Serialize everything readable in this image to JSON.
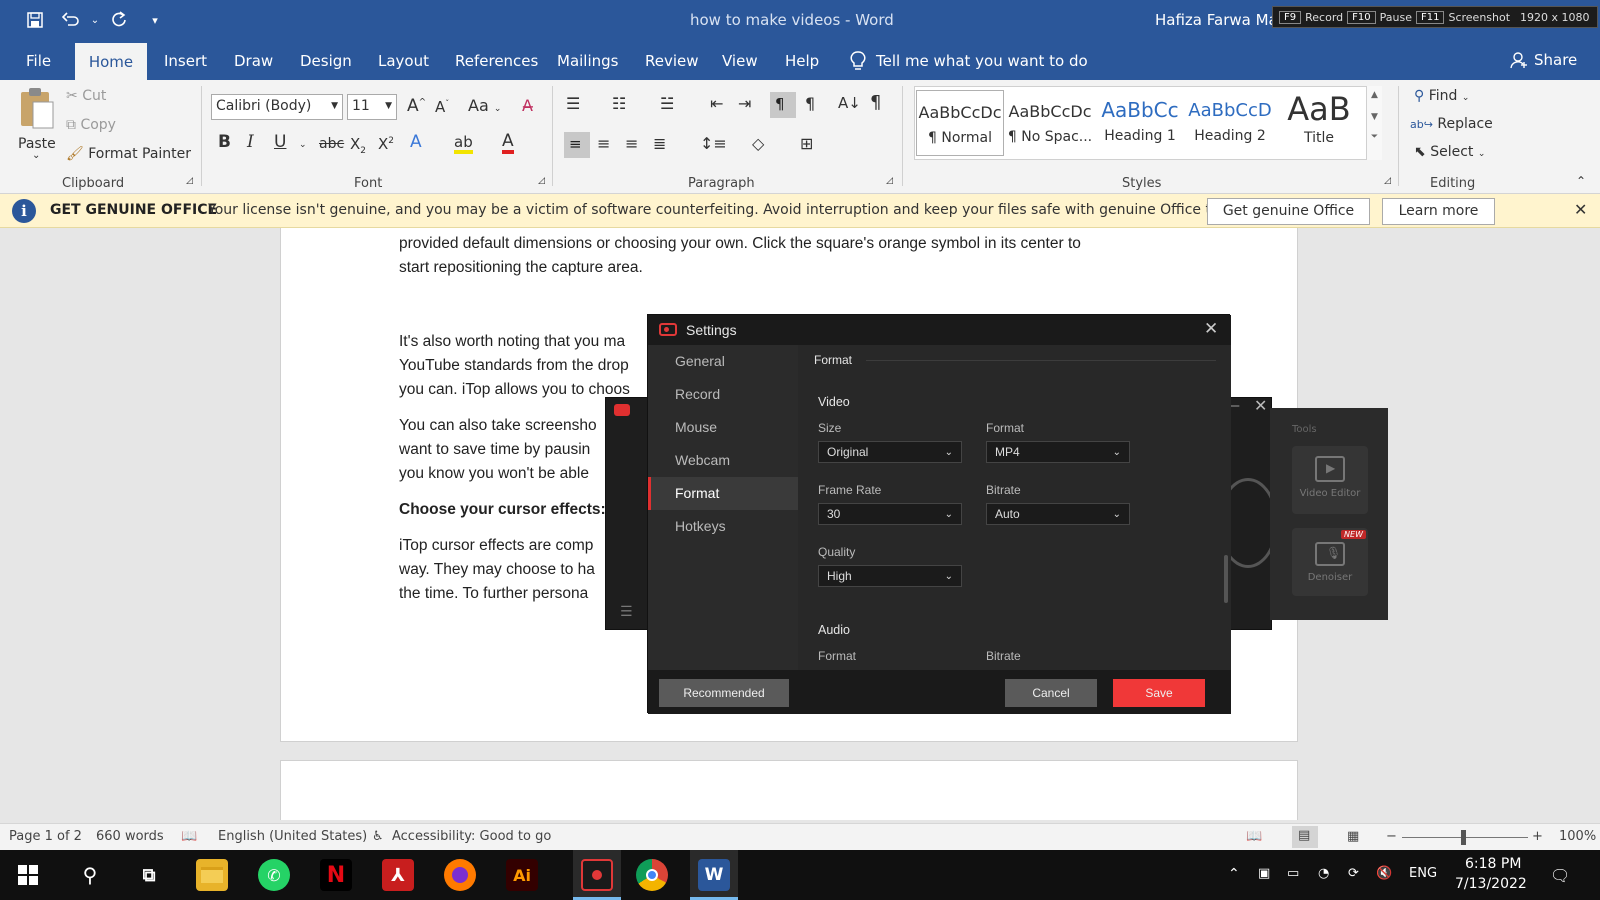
{
  "titlebar": {
    "doc_title": "how to make videos  -  Word",
    "user": "Hafiza Farwa Mah",
    "recorder_keys": [
      {
        "key": "F9",
        "label": "Record"
      },
      {
        "key": "F10",
        "label": "Pause"
      },
      {
        "key": "F11",
        "label": "Screenshot"
      }
    ],
    "resolution": "1920 x 1080"
  },
  "tabs": [
    "File",
    "Home",
    "Insert",
    "Draw",
    "Design",
    "Layout",
    "References",
    "Mailings",
    "Review",
    "View",
    "Help"
  ],
  "tell_me": "Tell me what you want to do",
  "share": "Share",
  "clipboard": {
    "paste": "Paste",
    "cut": "Cut",
    "copy": "Copy",
    "format_painter": "Format Painter",
    "label": "Clipboard"
  },
  "font": {
    "name": "Calibri (Body)",
    "size": "11",
    "label": "Font",
    "change_case": "Aa"
  },
  "paragraph": {
    "label": "Paragraph"
  },
  "styles": {
    "label": "Styles",
    "items": [
      {
        "preview": "AaBbCcDc",
        "name": "¶ Normal"
      },
      {
        "preview": "AaBbCcDc",
        "name": "¶ No Spac..."
      },
      {
        "preview": "AaBbCc",
        "name": "Heading 1"
      },
      {
        "preview": "AaBbCcD",
        "name": "Heading 2"
      },
      {
        "preview": "AaB",
        "name": "Title"
      }
    ]
  },
  "editing": {
    "find": "Find",
    "replace": "Replace",
    "select": "Select",
    "label": "Editing"
  },
  "banner": {
    "title": "GET GENUINE OFFICE",
    "message": "Your license isn't genuine, and you may be a victim of software counterfeiting. Avoid interruption and keep your files safe with genuine Office today.",
    "btn_genuine": "Get genuine Office",
    "btn_learn": "Learn more"
  },
  "document": {
    "lines": [
      "provided default dimensions or choosing your own. Click the square's orange symbol in its center to",
      "start repositioning the capture area.",
      "It's also worth noting that you ma",
      "YouTube standards from the drop",
      "you can. iTop allows you to choos",
      "You can also take screensho",
      "want to save time by pausin",
      "you know you won't be able",
      "Choose your cursor effects:",
      "iTop cursor effects are comp",
      "way. They may choose to ha",
      "the time. To further persona"
    ]
  },
  "itop": {
    "tools_title": "Tools",
    "video_editor": "Video Editor",
    "denoiser": "Denoiser",
    "new_badge": "NEW"
  },
  "settings": {
    "title": "Settings",
    "nav": [
      "General",
      "Record",
      "Mouse",
      "Webcam",
      "Format",
      "Hotkeys"
    ],
    "active": "Format",
    "section": "Format",
    "video": "Video",
    "size_label": "Size",
    "size": "Original",
    "format_label": "Format",
    "format": "MP4",
    "frame_rate_label": "Frame Rate",
    "frame_rate": "30",
    "bitrate_label": "Bitrate",
    "bitrate": "Auto",
    "quality_label": "Quality",
    "quality": "High",
    "audio": "Audio",
    "audio_format_label": "Format",
    "audio_bitrate_label": "Bitrate",
    "btn_recommended": "Recommended",
    "btn_cancel": "Cancel",
    "btn_save": "Save",
    "accent": "#f03838"
  },
  "statusbar": {
    "page": "Page 1 of 2",
    "words": "660 words",
    "language": "English (United States)",
    "accessibility": "Accessibility: Good to go",
    "zoom": "100%"
  },
  "taskbar": {
    "lang": "ENG",
    "time": "6:18 PM",
    "date": "7/13/2022"
  },
  "colors": {
    "word_blue": "#2b579a",
    "banner": "#fff4ce",
    "save_red": "#f03838"
  }
}
